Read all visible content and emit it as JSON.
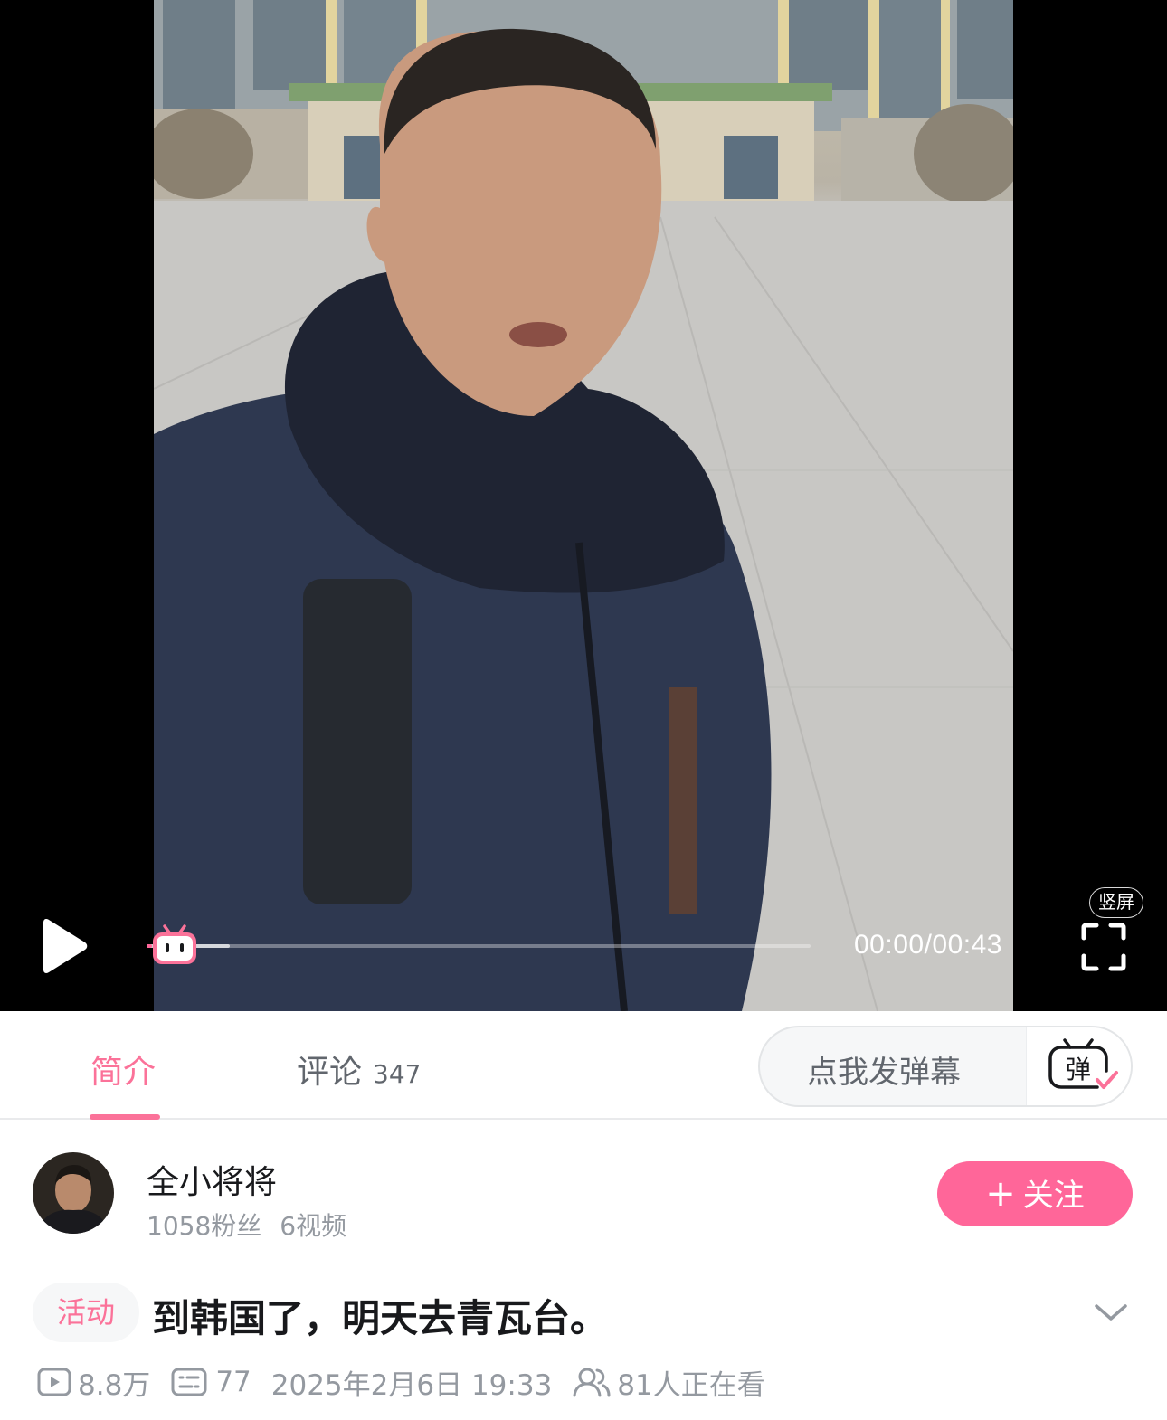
{
  "player": {
    "time_display": "00:00/00:43",
    "progress_fraction": 0.0,
    "buffered_fraction": 0.125,
    "vertical_badge": "竖屏",
    "icons": [
      "play-icon",
      "danmaku-thumb-icon",
      "fullscreen-icon"
    ]
  },
  "tabs": {
    "intro": "简介",
    "comments": "评论",
    "comments_count": "347",
    "active": "intro"
  },
  "danmaku": {
    "placeholder": "点我发弹幕",
    "toggle_glyph": "弹"
  },
  "uploader": {
    "name": "全小将将",
    "fans": "1058粉丝",
    "videos": "6视频",
    "follow_plus": "+",
    "follow_label": "关注"
  },
  "video": {
    "tag": "活动",
    "title": "到韩国了，明天去青瓦台。",
    "views": "8.8万",
    "danmaku_count": "77",
    "date": "2025年2月6日 19:33",
    "watching": "81人正在看"
  },
  "colors": {
    "accent_pink": "#fb7299",
    "follow_pink": "#ff6699",
    "secondary_text": "#9499a0"
  }
}
